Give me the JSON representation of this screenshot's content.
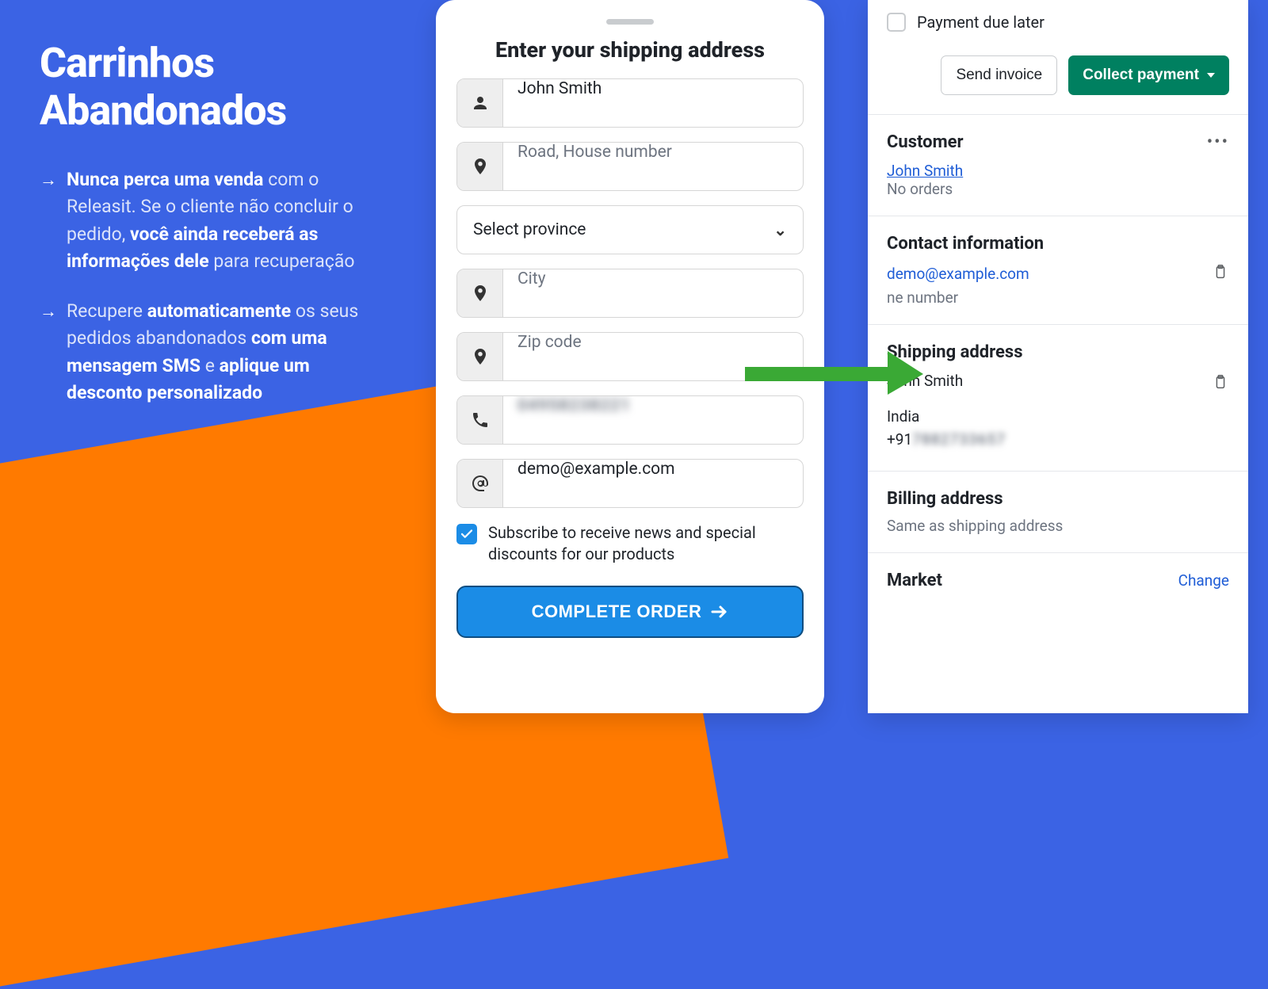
{
  "left": {
    "title": "Carrinhos Abandonados",
    "bullet1_bold_lead": "Nunca perca uma venda",
    "bullet1_text_a": " com o Releasit. Se o cliente não concluir o pedido, ",
    "bullet1_bold_mid": "você ainda receberá as informações dele",
    "bullet1_text_b": " para recuperação",
    "bullet2_text_a": "Recupere ",
    "bullet2_bold_a": "automaticamente",
    "bullet2_text_b": " os seus pedidos abandonados ",
    "bullet2_bold_b": "com uma mensagem SMS",
    "bullet2_text_c": " e ",
    "bullet2_bold_c": "aplique um desconto personalizado"
  },
  "checkout": {
    "heading": "Enter your shipping address",
    "name_value": "John Smith",
    "road_placeholder": "Road, House number",
    "province_placeholder": "Select province",
    "city_placeholder": "City",
    "zip_placeholder": "Zip code",
    "phone_obscured": "04958238221",
    "email_value": "demo@example.com",
    "subscribe_label": "Subscribe to receive news and special discounts for our products",
    "cta_label": "COMPLETE ORDER"
  },
  "admin": {
    "pay_later_label": "Payment due later",
    "send_invoice_label": "Send invoice",
    "collect_payment_label": "Collect payment",
    "customer_heading": "Customer",
    "customer_name": "John Smith",
    "customer_orders": "No orders",
    "contact_heading": "Contact information",
    "contact_email": "demo@example.com",
    "contact_phone_placeholder": "ne number",
    "shipping_heading": "Shipping address",
    "shipping_name": "John Smith",
    "shipping_country": "India",
    "shipping_phone_prefix": "+91",
    "shipping_phone_rest": "7882733657",
    "billing_heading": "Billing address",
    "billing_value": "Same as shipping address",
    "market_heading": "Market",
    "change_label": "Change"
  }
}
